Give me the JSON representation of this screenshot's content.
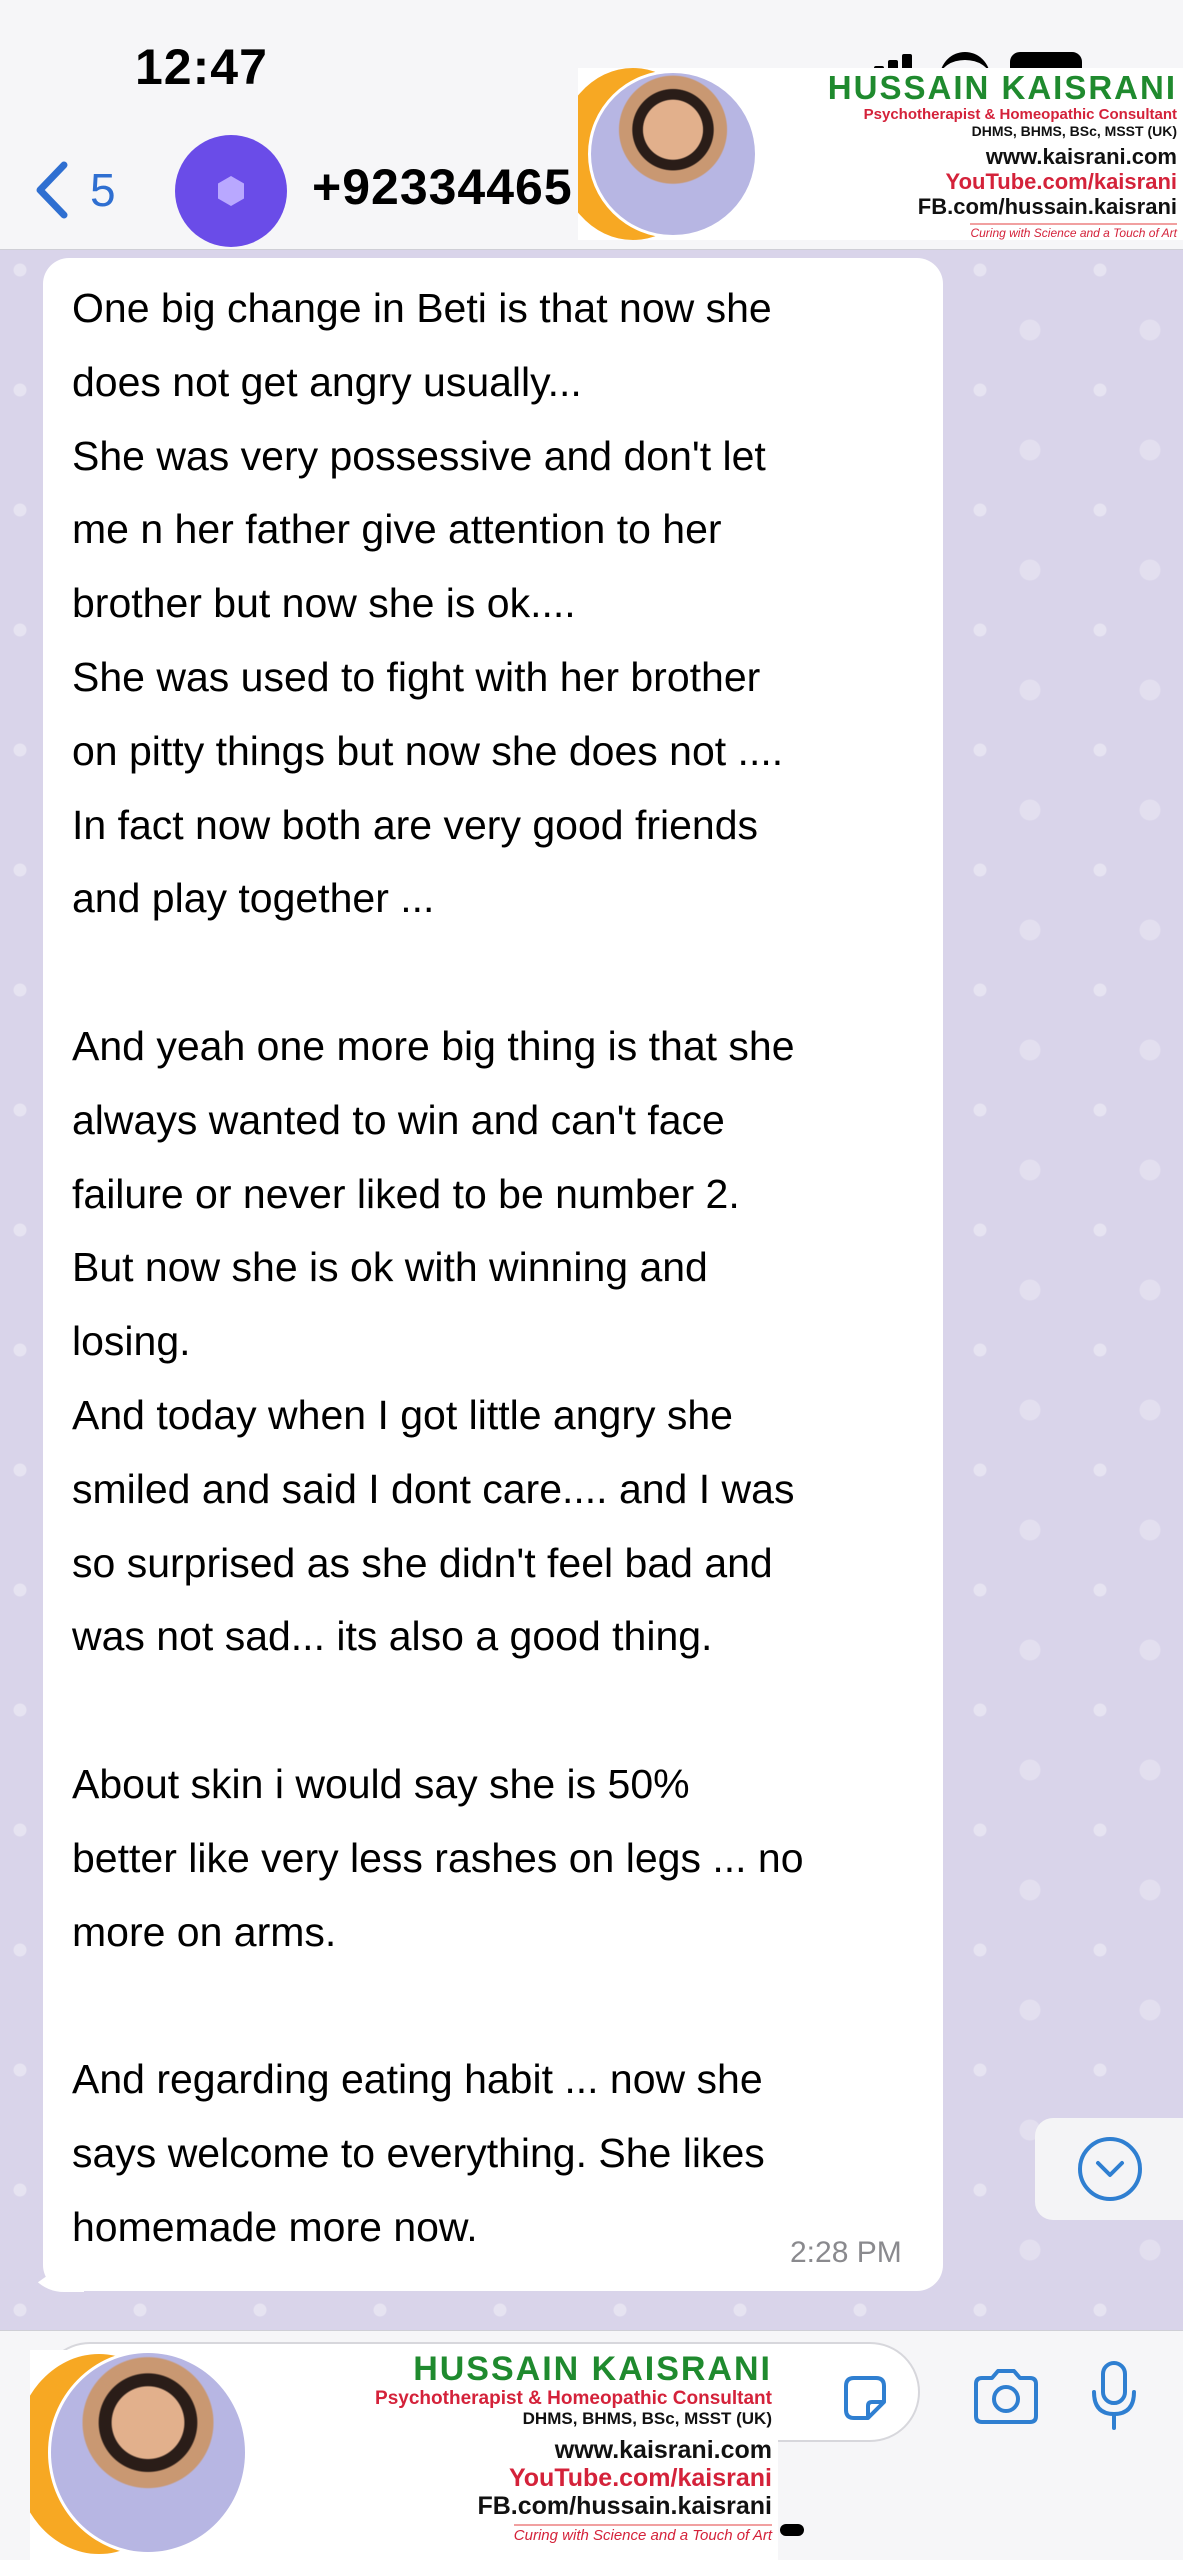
{
  "status_bar": {
    "time": "12:47"
  },
  "header": {
    "back_count": "5",
    "contact_name": "+92334465"
  },
  "branding": {
    "name": "HUSSAIN KAISRANI",
    "subtitle": "Psychotherapist & Homeopathic Consultant",
    "degrees": "DHMS, BHMS, BSc, MSST (UK)",
    "website": "www.kaisrani.com",
    "youtube": "YouTube.com/kaisrani",
    "facebook": "FB.com/hussain.kaisrani",
    "tagline": "Curing with Science and a Touch of Art"
  },
  "message": {
    "text": "One big change in Beti is that now she\ndoes not get angry usually...\nShe was very possessive and don't let\nme n her father give attention to her\nbrother but now she is ok....\nShe was used to fight with her brother\non pitty things but now she does not ....\nIn fact now both are very good friends\nand play together ...\n\nAnd yeah one more big thing is that she\nalways wanted to win and can't face\nfailure or never liked to be number 2.\nBut now she is ok with winning and\nlosing.\nAnd today when I got little angry she\nsmiled and said I dont care.... and I was\nso surprised as she didn't feel bad and\nwas not sad... its also a good thing.\n\nAbout skin i would say she is 50%\nbetter like very less rashes on legs ... no\nmore on arms.\n\nAnd regarding eating habit ... now she\nsays welcome to everything. She likes\nhomemade more now.",
    "time": "2:28 PM"
  },
  "icons": {
    "back": "chevron-left-icon",
    "avatar": "hexagon-icon",
    "scroll": "chevron-down-icon",
    "sticker": "sticker-icon",
    "camera": "camera-icon",
    "mic": "microphone-icon"
  },
  "colors": {
    "accent": "#2f6fd1",
    "avatar": "#6a4ce8",
    "chat_background": "#d9d4ea",
    "brand_green": "#1f8a2e",
    "brand_red": "#d4223a"
  }
}
